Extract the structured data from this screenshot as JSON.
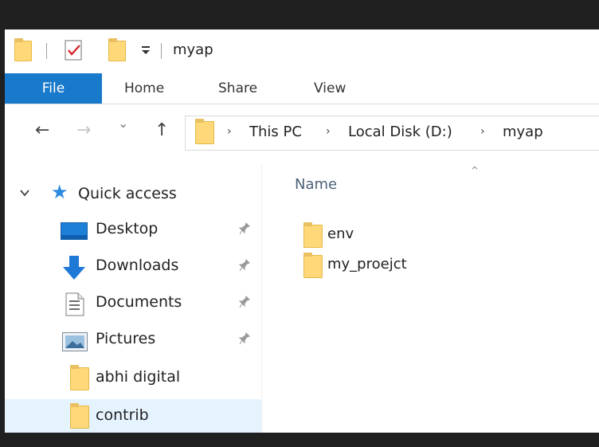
{
  "window": {
    "title": "myap"
  },
  "quick_access_toolbar": {
    "items": [
      "folder-icon",
      "properties-icon",
      "new-folder-icon",
      "customize-dropdown-icon"
    ]
  },
  "ribbon": {
    "tabs": [
      {
        "label": "File",
        "active": true
      },
      {
        "label": "Home"
      },
      {
        "label": "Share"
      },
      {
        "label": "View"
      }
    ],
    "file_tab_color": "#1979CA"
  },
  "navigation": {
    "back": "←",
    "forward": "→",
    "recent": "⌄",
    "up": "↑"
  },
  "address_bar": {
    "path": [
      "This PC",
      "Local Disk (D:)",
      "myap"
    ],
    "separator": "›"
  },
  "nav_pane": {
    "quick_access_label": "Quick access",
    "items": [
      {
        "label": "Desktop",
        "icon": "desktop-icon",
        "pinned": true
      },
      {
        "label": "Downloads",
        "icon": "downloads-icon",
        "pinned": true
      },
      {
        "label": "Documents",
        "icon": "documents-icon",
        "pinned": true
      },
      {
        "label": "Pictures",
        "icon": "pictures-icon",
        "pinned": true
      },
      {
        "label": "abhi digital",
        "icon": "folder-icon",
        "pinned": false
      },
      {
        "label": "contrib",
        "icon": "folder-icon",
        "pinned": false,
        "selected": true
      }
    ],
    "pin_glyph": "📌",
    "selection_color": "#E5F3FF"
  },
  "content": {
    "column_header": "Name",
    "sort_glyph": "^",
    "files": [
      {
        "name": "env",
        "type": "folder"
      },
      {
        "name": "my_proejct",
        "type": "folder"
      }
    ],
    "folder_color": "#FFD87A"
  }
}
